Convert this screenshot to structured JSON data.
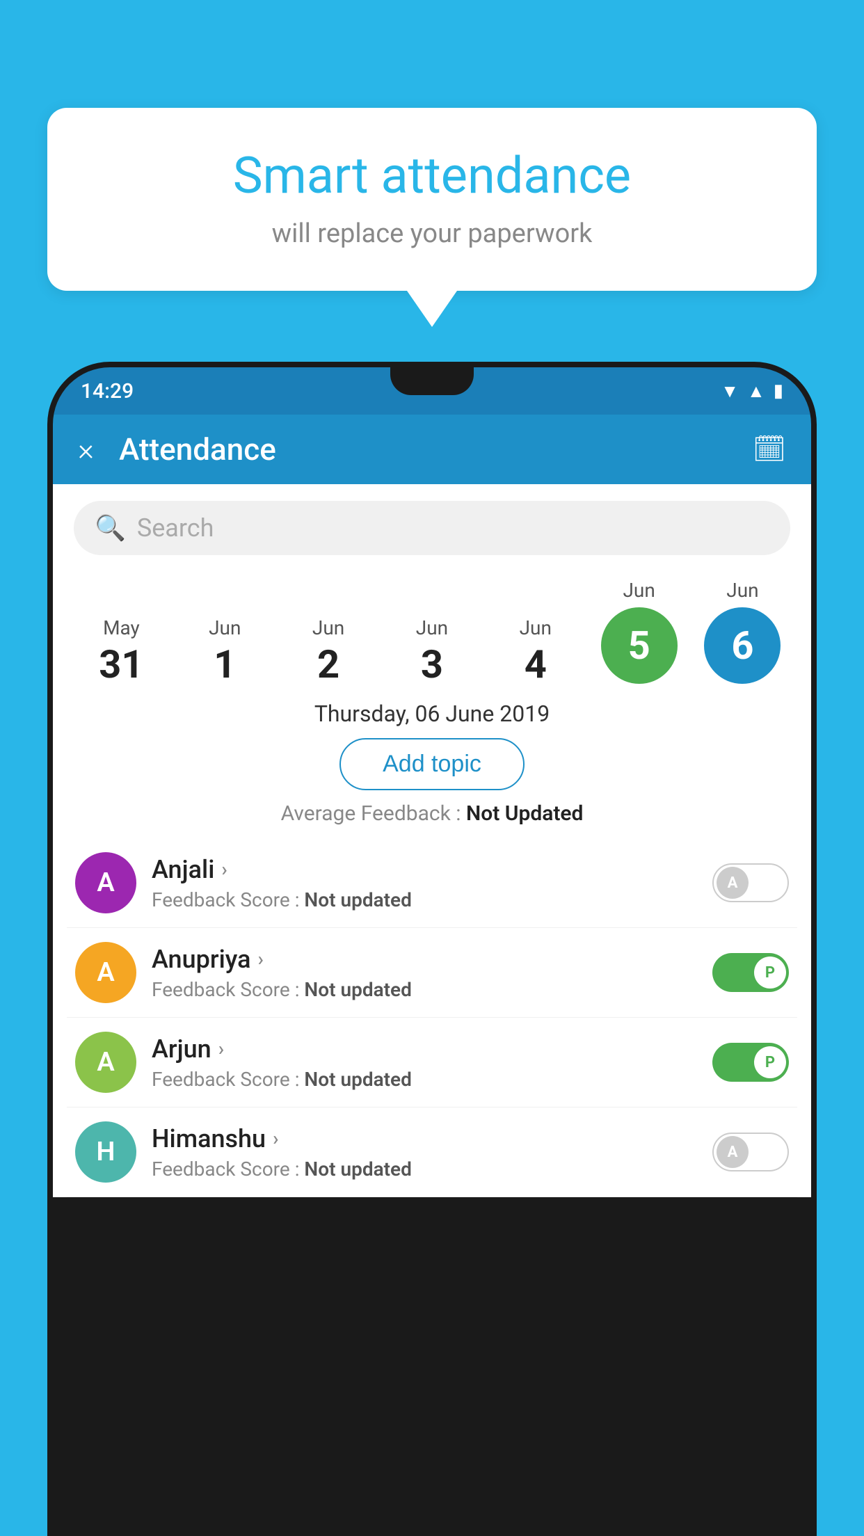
{
  "background_color": "#29b6e8",
  "speech_bubble": {
    "title": "Smart attendance",
    "subtitle": "will replace your paperwork"
  },
  "status_bar": {
    "time": "14:29",
    "icons": [
      "wifi",
      "signal",
      "battery"
    ]
  },
  "toolbar": {
    "title": "Attendance",
    "close_label": "×",
    "calendar_icon": "📅"
  },
  "search": {
    "placeholder": "Search"
  },
  "date_strip": {
    "dates": [
      {
        "month": "May",
        "day": "31",
        "selected": false,
        "today": false
      },
      {
        "month": "Jun",
        "day": "1",
        "selected": false,
        "today": false
      },
      {
        "month": "Jun",
        "day": "2",
        "selected": false,
        "today": false
      },
      {
        "month": "Jun",
        "day": "3",
        "selected": false,
        "today": false
      },
      {
        "month": "Jun",
        "day": "4",
        "selected": false,
        "today": false
      },
      {
        "month": "Jun",
        "day": "5",
        "selected": true,
        "today": true
      },
      {
        "month": "Jun",
        "day": "6",
        "selected": true,
        "today": false
      }
    ]
  },
  "selected_date_label": "Thursday, 06 June 2019",
  "add_topic_button": "Add topic",
  "avg_feedback_label": "Average Feedback :",
  "avg_feedback_value": "Not Updated",
  "students": [
    {
      "name": "Anjali",
      "initial": "A",
      "avatar_color": "purple",
      "feedback_label": "Feedback Score :",
      "feedback_value": "Not updated",
      "attendance": "absent"
    },
    {
      "name": "Anupriya",
      "initial": "A",
      "avatar_color": "yellow",
      "feedback_label": "Feedback Score :",
      "feedback_value": "Not updated",
      "attendance": "present"
    },
    {
      "name": "Arjun",
      "initial": "A",
      "avatar_color": "light-green",
      "feedback_label": "Feedback Score :",
      "feedback_value": "Not updated",
      "attendance": "present"
    },
    {
      "name": "Himanshu",
      "initial": "H",
      "avatar_color": "teal",
      "feedback_label": "Feedback Score :",
      "feedback_value": "Not updated",
      "attendance": "absent"
    }
  ]
}
